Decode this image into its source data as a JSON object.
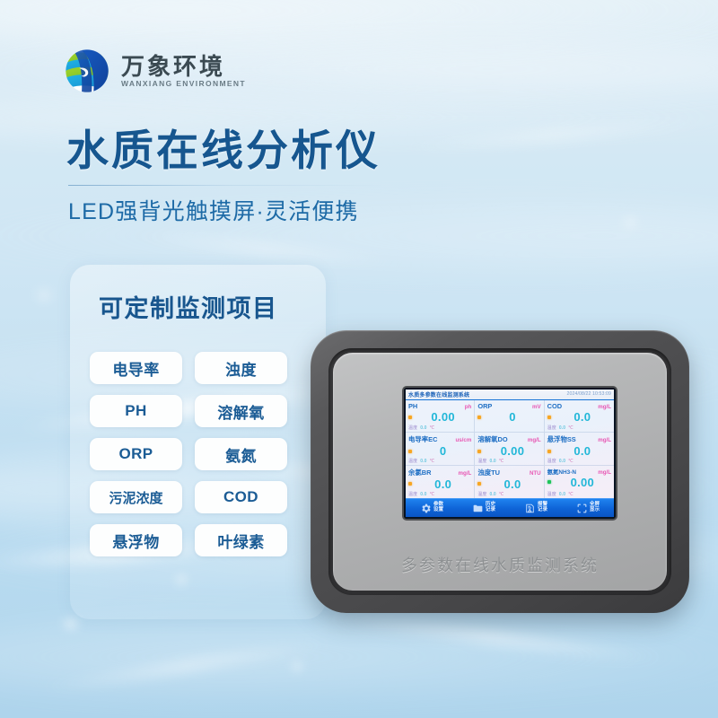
{
  "brand": {
    "logo_icon": "globe-swirl-logo",
    "name_cn": "万象环境",
    "name_en": "WANXIANG ENVIRONMENT"
  },
  "hero": {
    "title": "水质在线分析仪",
    "subtitle": "LED强背光触摸屏·灵活便携"
  },
  "items_card": {
    "heading": "可定制监测项目",
    "pills": [
      {
        "label": "电导率"
      },
      {
        "label": "浊度"
      },
      {
        "label": "PH"
      },
      {
        "label": "溶解氧"
      },
      {
        "label": "ORP"
      },
      {
        "label": "氨氮"
      },
      {
        "label": "污泥浓度"
      },
      {
        "label": "COD"
      },
      {
        "label": "悬浮物"
      },
      {
        "label": "叶绿素"
      }
    ]
  },
  "device": {
    "caption": "多参数在线水质监测系统",
    "screen": {
      "system_title": "水质多参数在线监测系统",
      "timestamp": "2024/08/22 10:53:09",
      "temp_label": "温度",
      "temp_value": "0.0",
      "temp_unit": "℃",
      "parameters": [
        {
          "name": "PH",
          "unit": "ph",
          "value": "0.00",
          "status": "orange",
          "has_temp": true
        },
        {
          "name": "ORP",
          "unit": "mV",
          "value": "0",
          "status": "orange",
          "has_temp": false
        },
        {
          "name": "COD",
          "unit": "mg/L",
          "value": "0.0",
          "status": "orange",
          "has_temp": true
        },
        {
          "name": "电导率EC",
          "unit": "us/cm",
          "value": "0",
          "status": "orange",
          "has_temp": true
        },
        {
          "name": "溶解氧DO",
          "unit": "mg/L",
          "value": "0.00",
          "status": "orange",
          "has_temp": true
        },
        {
          "name": "悬浮物SS",
          "unit": "mg/L",
          "value": "0.0",
          "status": "orange",
          "has_temp": true
        },
        {
          "name": "余氯BR",
          "unit": "mg/L",
          "value": "0.0",
          "status": "orange",
          "has_temp": true
        },
        {
          "name": "浊度TU",
          "unit": "NTU",
          "value": "0.0",
          "status": "orange",
          "has_temp": true
        },
        {
          "name": "氨氮NH3-N",
          "unit": "mg/L",
          "value": "0.00",
          "status": "green",
          "has_temp": true
        }
      ],
      "toolbar": [
        {
          "icon": "gear-icon",
          "line1": "参数",
          "line2": "设置"
        },
        {
          "icon": "folder-icon",
          "line1": "历史",
          "line2": "记录"
        },
        {
          "icon": "alarm-doc-icon",
          "line1": "报警",
          "line2": "记录"
        },
        {
          "icon": "fullscreen-icon",
          "line1": "全屏",
          "line2": "显示"
        }
      ]
    }
  },
  "colors": {
    "brand_blue": "#16568f",
    "lcd_value_cyan": "#22b7d8",
    "lcd_unit_pink": "#e858b4",
    "lcd_toolbar_blue": "#0e63d6",
    "status_orange": "#f7a623",
    "status_green": "#1ec45a"
  }
}
